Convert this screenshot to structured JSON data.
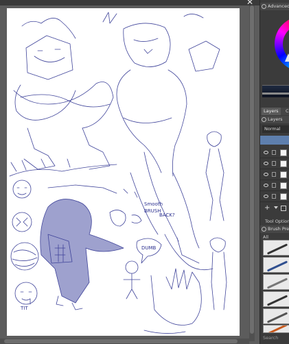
{
  "window": {
    "close_glyph": "✕"
  },
  "dock": {
    "advanced_color_title": "Advanced",
    "layers_tab": "Layers",
    "other_tab": "C",
    "layers_title": "Layers",
    "blend_mode": "Normal",
    "tool_options_label": "Tool Option",
    "brush_presets_title": "Brush Pre",
    "brush_filter": "All",
    "search_placeholder": "Search",
    "add_layer_glyph": "+"
  },
  "colors": {
    "accent": "#5e7fae",
    "canvas": "#ffffff",
    "sketch_ink": "#2a2f8f",
    "dock_bg": "#3b3b3b"
  },
  "icons": [
    "close-icon",
    "color-wheel-icon",
    "eye-icon",
    "lock-icon",
    "add-layer-icon",
    "brush-preset-icon"
  ],
  "canvas": {
    "annotations": [
      "TIT",
      "Smooth",
      "BRUSH",
      "DUMB",
      "BACK?"
    ]
  }
}
